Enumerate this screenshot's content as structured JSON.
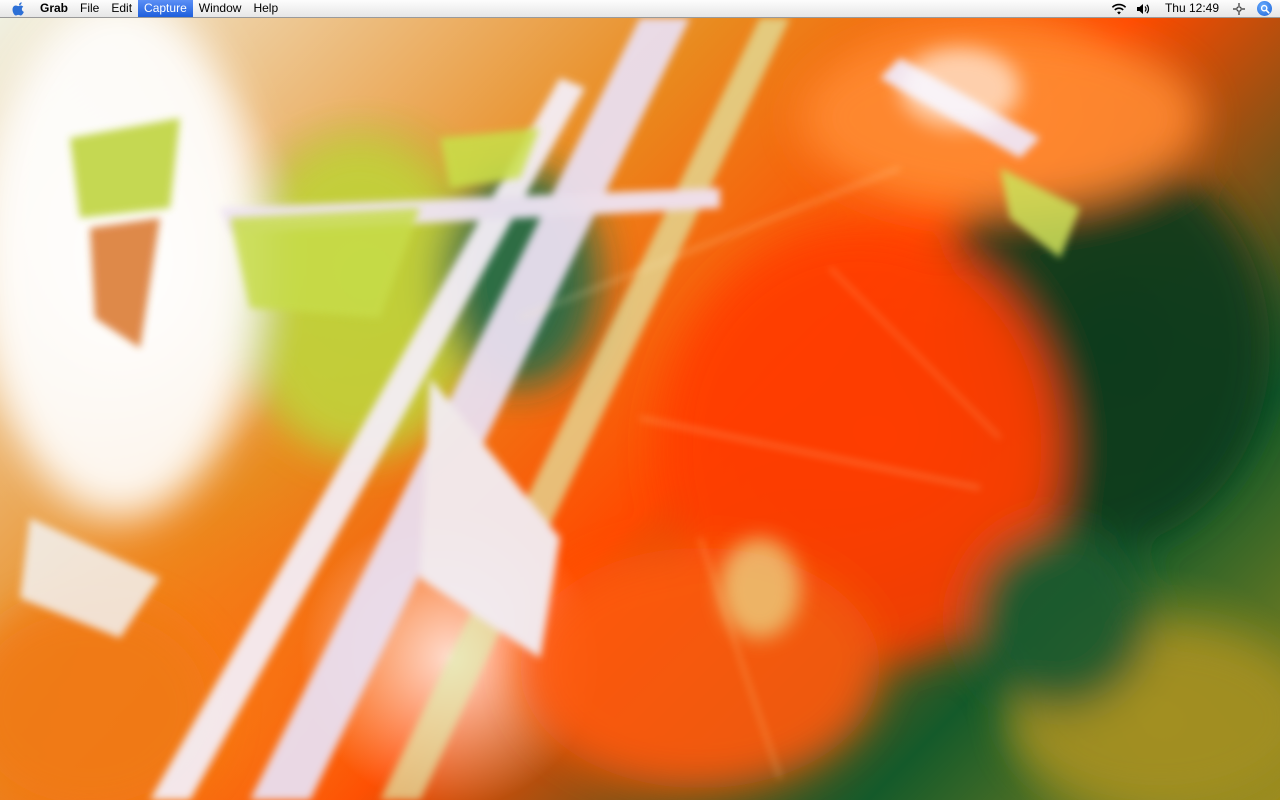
{
  "menubar": {
    "apple_icon": "apple-logo-icon",
    "app_name": "Grab",
    "menus": [
      "File",
      "Edit",
      "Capture",
      "Window",
      "Help"
    ],
    "active_menu": "Capture",
    "status": {
      "wifi_icon": "wifi-icon",
      "volume_icon": "volume-icon",
      "clock": "Thu 12:49",
      "extra_icon": "move-crosshair-icon",
      "spotlight_icon": "spotlight-search-icon"
    }
  },
  "desktop": {
    "wallpaper": "abstract-orange-green-wallpaper",
    "colors": {
      "white": "#ffffff",
      "lime": "#c8e040",
      "orange": "#f07a18",
      "red_orange": "#ff4400",
      "dark_green": "#0e4a28",
      "olive": "#9a8a1e",
      "lavender": "#e6dcf0"
    }
  },
  "accent_color": "#2a6ae0"
}
